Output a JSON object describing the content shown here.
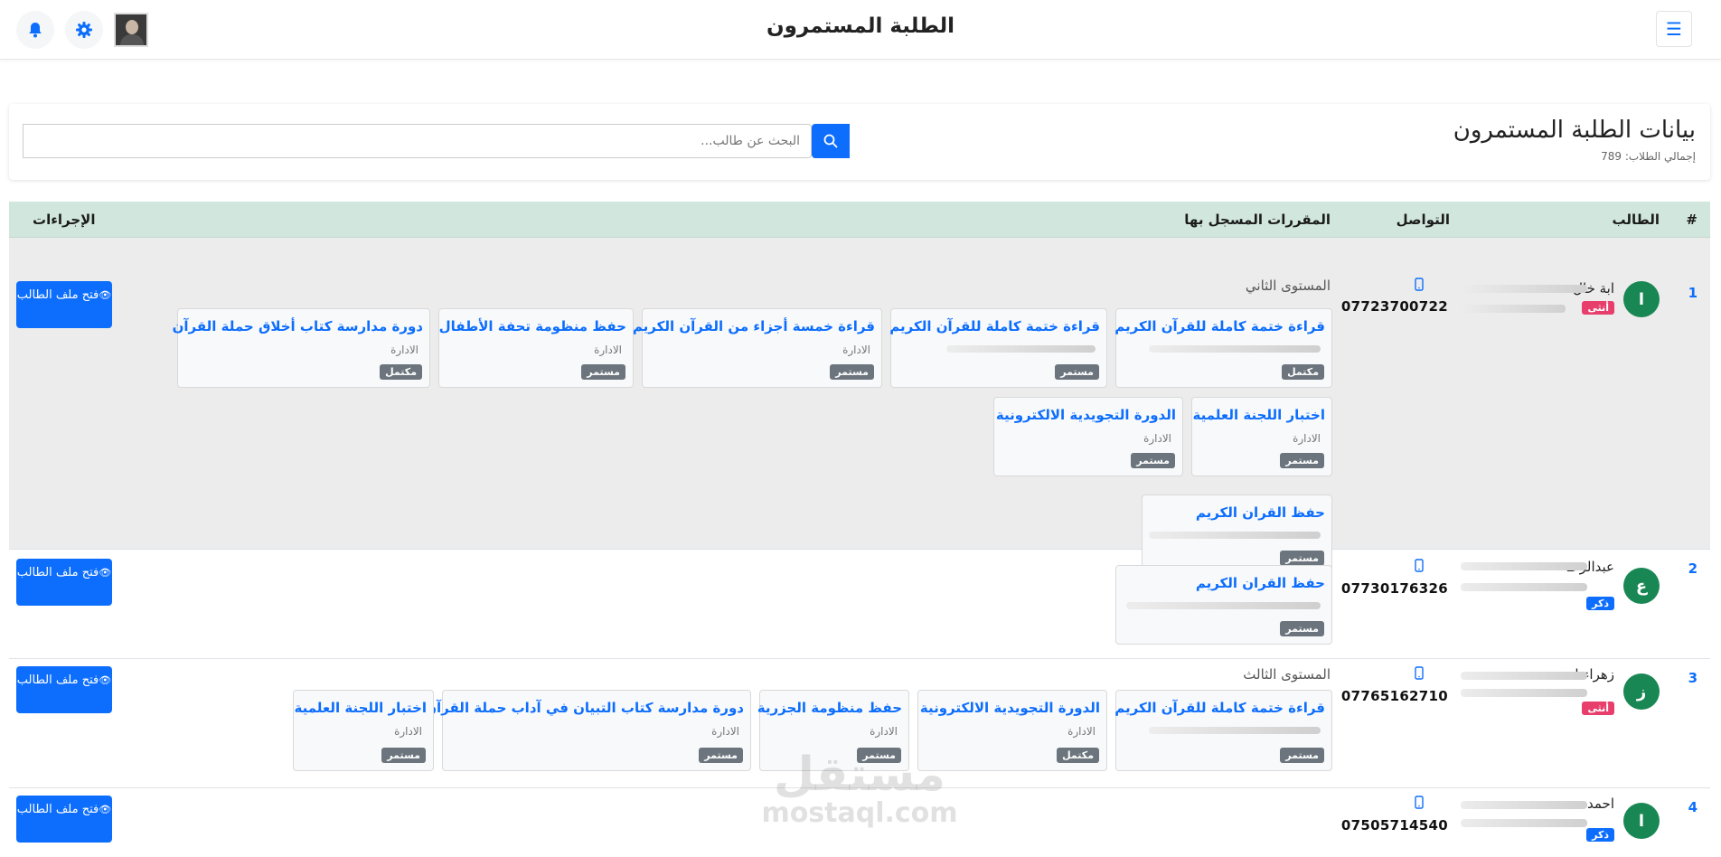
{
  "topbar": {
    "title": "الطلبة المستمرون"
  },
  "header": {
    "title": "بيانات الطلبة المستمرون",
    "total": "إجمالي الطلاب: 789",
    "search_placeholder": "البحث عن طالب..."
  },
  "table": {
    "headers": {
      "num": "#",
      "student": "الطالب",
      "contact": "التواصل",
      "courses": "المقررات المسجل بها",
      "actions": "الإجراءات"
    },
    "action_label": "فتح ملف الطالب",
    "rows": [
      {
        "num": "1",
        "initial": "ا",
        "name": "ابة خال",
        "gender": "أنثى",
        "phone": "07723700722",
        "level": "المستوى الثاني",
        "courses": [
          {
            "title": "قراءة ختمة كاملة للقرآن الكريم",
            "source": "",
            "status": "مكتمل"
          },
          {
            "title": "قراءة ختمة كاملة للقرآن الكريم",
            "source": "",
            "status": "مستمر"
          },
          {
            "title": "قراءة خمسة أجزاء من القرآن الكريم",
            "source": "الادارة",
            "status": "مستمر"
          },
          {
            "title": "حفظ منظومة تحفة الأطفال",
            "source": "الادارة",
            "status": "مستمر"
          },
          {
            "title": "دورة مدارسة كتاب أخلاق حملة القرآن",
            "source": "الادارة",
            "status": "مكتمل"
          },
          {
            "title": "اختبار اللجنة العلمية",
            "source": "الادارة",
            "status": "مستمر"
          },
          {
            "title": "الدورة التجويدية الالكترونية",
            "source": "الادارة",
            "status": "مستمر"
          },
          {
            "title": "حفظ القران الكريم",
            "source": "",
            "status": "مستمر"
          }
        ]
      },
      {
        "num": "2",
        "initial": "ع",
        "name": "عبدالرحـ",
        "gender": "ذكر",
        "phone": "07730176326",
        "level": "",
        "courses": [
          {
            "title": "حفظ القران الكريم",
            "source": "",
            "status": "مستمر"
          }
        ]
      },
      {
        "num": "3",
        "initial": "ز",
        "name": "زهراء ا",
        "gender": "أنثى",
        "phone": "07765162710",
        "level": "المستوى الثالث",
        "courses": [
          {
            "title": "قراءة ختمة كاملة للقرآن الكريم",
            "source": "",
            "status": "مستمر"
          },
          {
            "title": "الدورة التجويدية الالكترونية",
            "source": "الادارة",
            "status": "مكتمل"
          },
          {
            "title": "حفظ منظومة الجزرية",
            "source": "الادارة",
            "status": "مستمر"
          },
          {
            "title": "دورة مدارسة كتاب التبيان في آداب حملة القرآن",
            "source": "الادارة",
            "status": "مستمر"
          },
          {
            "title": "اختبار اللجنة العلمية",
            "source": "الادارة",
            "status": "مستمر"
          }
        ]
      },
      {
        "num": "4",
        "initial": "ا",
        "name": "احمد ء",
        "gender": "ذكر",
        "phone": "07505714540",
        "level": "",
        "courses": []
      }
    ]
  },
  "watermark": {
    "line1": "مستقل",
    "line2": "mostaql.com"
  }
}
